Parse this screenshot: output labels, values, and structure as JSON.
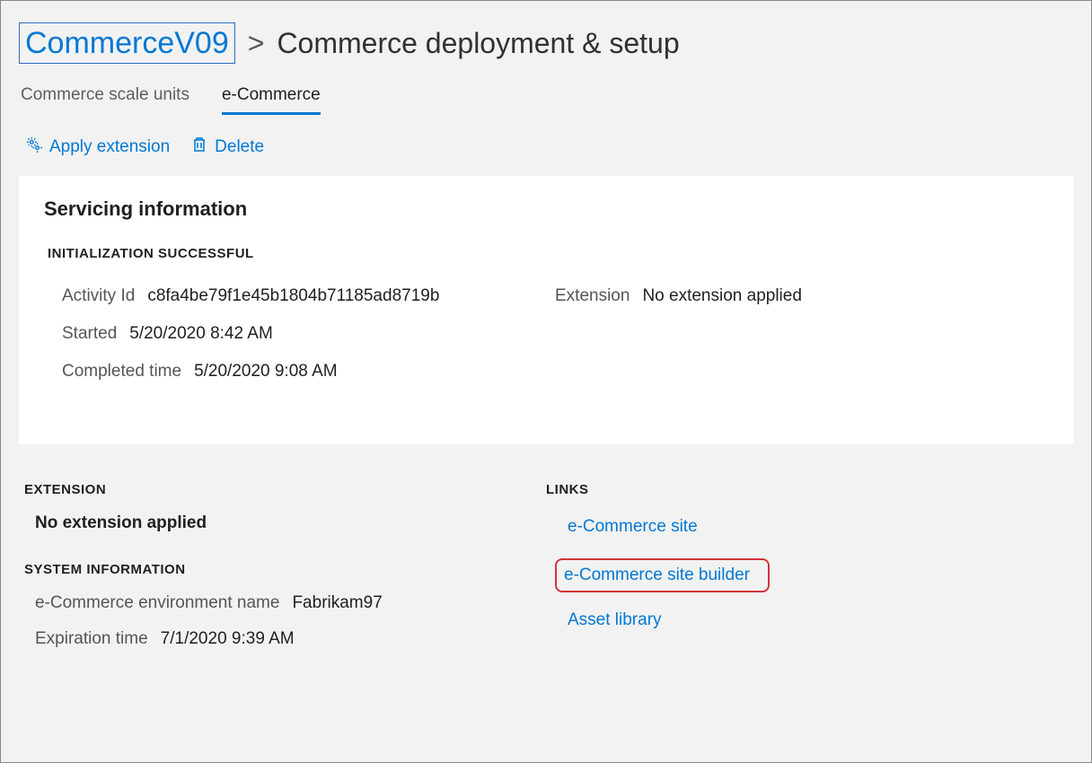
{
  "breadcrumb": {
    "link": "CommerceV09",
    "separator": ">",
    "current": "Commerce deployment & setup"
  },
  "tabs": [
    {
      "label": "Commerce scale units",
      "active": false
    },
    {
      "label": "e-Commerce",
      "active": true
    }
  ],
  "toolbar": {
    "apply_extension": "Apply extension",
    "delete": "Delete"
  },
  "servicing": {
    "title": "Servicing information",
    "status": "INITIALIZATION SUCCESSFUL",
    "activity_id_label": "Activity Id",
    "activity_id_value": "c8fa4be79f1e45b1804b71185ad8719b",
    "started_label": "Started",
    "started_value": "5/20/2020 8:42 AM",
    "completed_label": "Completed time",
    "completed_value": "5/20/2020 9:08 AM",
    "extension_label": "Extension",
    "extension_value": "No extension applied"
  },
  "extension_section": {
    "heading": "EXTENSION",
    "value": "No extension applied"
  },
  "system_info": {
    "heading": "SYSTEM INFORMATION",
    "env_name_label": "e-Commerce environment name",
    "env_name_value": "Fabrikam97",
    "expiration_label": "Expiration time",
    "expiration_value": "7/1/2020 9:39 AM"
  },
  "links_section": {
    "heading": "LINKS",
    "items": [
      "e-Commerce site",
      "e-Commerce site builder",
      "Asset library"
    ]
  }
}
